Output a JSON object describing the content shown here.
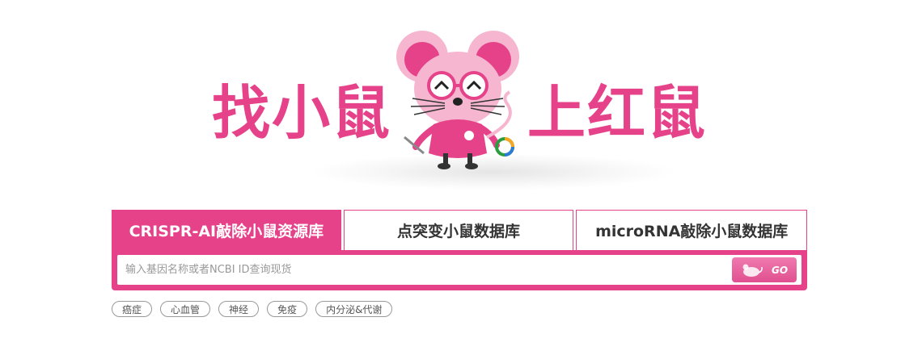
{
  "hero": {
    "slogan_left": "找小鼠",
    "slogan_right": "上红鼠"
  },
  "tabs": [
    {
      "label": "CRISPR-AI敲除小鼠资源库",
      "active": true
    },
    {
      "label": "点突变小鼠数据库",
      "active": false
    },
    {
      "label": "microRNA敲除小鼠数据库",
      "active": false
    }
  ],
  "search": {
    "placeholder": "输入基因名称或者NCBI ID查询现货",
    "value": "",
    "go_label": "GO"
  },
  "tags": [
    "癌症",
    "心血管",
    "神经",
    "免疫",
    "内分泌&代谢"
  ],
  "colors": {
    "accent": "#e6428a",
    "text": "#333333",
    "tag_border": "#999999"
  },
  "icons": {
    "mascot": "mascot-mouse-icon",
    "go": "mouse-go-icon"
  }
}
